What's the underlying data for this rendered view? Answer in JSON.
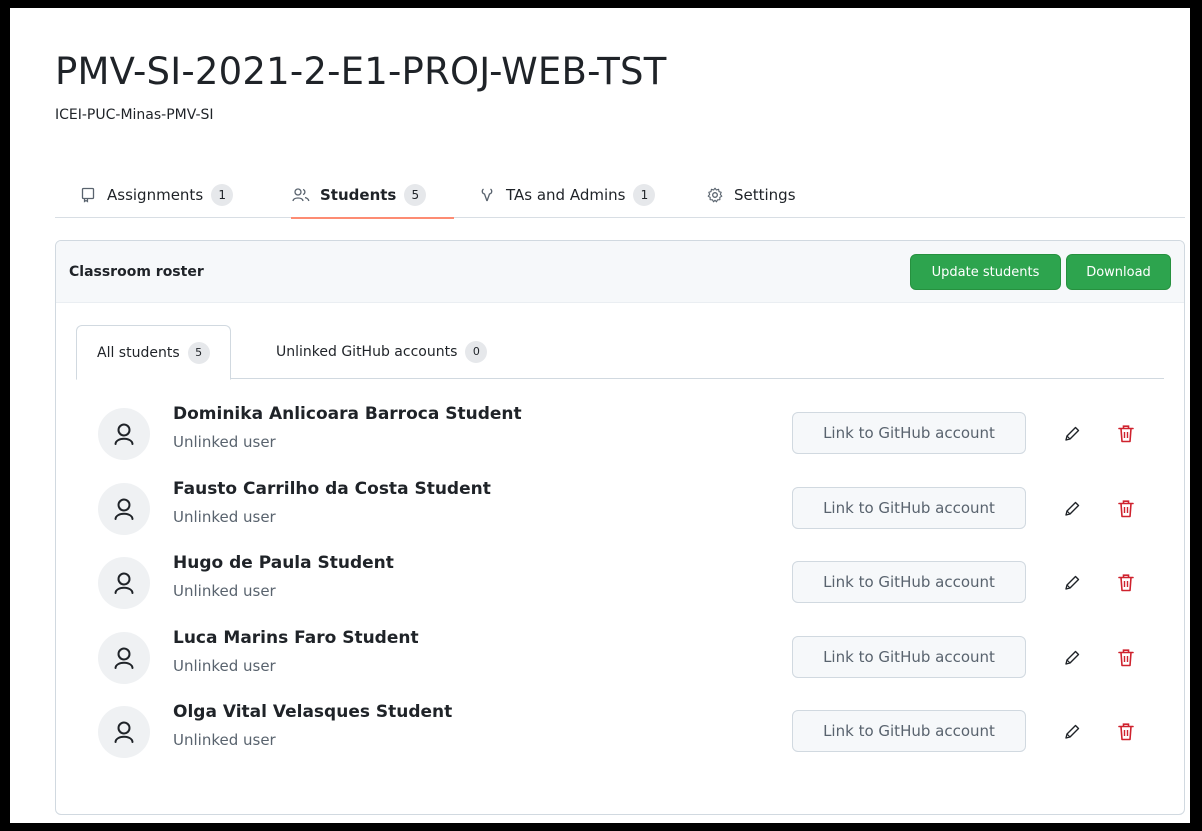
{
  "header": {
    "title": "PMV-SI-2021-2-E1-PROJ-WEB-TST",
    "org": "ICEI-PUC-Minas-PMV-SI"
  },
  "tabs": [
    {
      "label": "Assignments",
      "count": "1",
      "icon": "repo-icon"
    },
    {
      "label": "Students",
      "count": "5",
      "icon": "people-icon"
    },
    {
      "label": "TAs and Admins",
      "count": "1",
      "icon": "tools-icon"
    },
    {
      "label": "Settings",
      "icon": "gear-icon"
    }
  ],
  "roster": {
    "title": "Classroom roster",
    "update_label": "Update students",
    "download_label": "Download",
    "subtabs": [
      {
        "label": "All students",
        "count": "5"
      },
      {
        "label": "Unlinked GitHub accounts",
        "count": "0"
      }
    ],
    "students": [
      {
        "name": "Dominika Anlicoara Barroca Student",
        "status": "Unlinked user",
        "link_label": "Link to GitHub account"
      },
      {
        "name": "Fausto Carrilho da Costa Student",
        "status": "Unlinked user",
        "link_label": "Link to GitHub account"
      },
      {
        "name": "Hugo de Paula Student",
        "status": "Unlinked user",
        "link_label": "Link to GitHub account"
      },
      {
        "name": "Luca Marins Faro Student",
        "status": "Unlinked user",
        "link_label": "Link to GitHub account"
      },
      {
        "name": "Olga Vital Velasques Student",
        "status": "Unlinked user",
        "link_label": "Link to GitHub account"
      }
    ]
  },
  "colors": {
    "primary_green": "#2da44e",
    "active_tab_underline": "#fd8c73",
    "danger_red": "#cf222e"
  }
}
